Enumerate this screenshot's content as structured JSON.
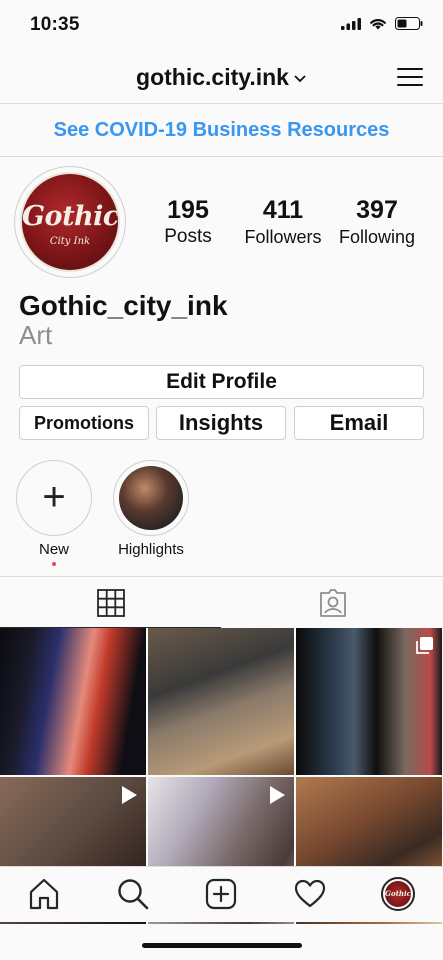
{
  "status_bar": {
    "time": "10:35"
  },
  "header": {
    "username": "gothic.city.ink"
  },
  "banner": {
    "text": "See COVID-19 Business Resources"
  },
  "profile": {
    "avatar_text": "Gothic",
    "avatar_subtext": "City Ink",
    "posts_count": "195",
    "posts_label": "Posts",
    "followers_count": "411",
    "followers_label": "Followers",
    "following_count": "397",
    "following_label": "Following",
    "display_name": "Gothic_city_ink",
    "category": "Art"
  },
  "buttons": {
    "edit_profile": "Edit Profile",
    "promotions": "Promotions",
    "insights": "Insights",
    "email": "Email"
  },
  "highlights": [
    {
      "label": "New",
      "icon": "plus-icon"
    },
    {
      "label": "Highlights",
      "icon": "highlight-photo"
    }
  ],
  "tabs": [
    {
      "icon": "grid-icon",
      "selected": true
    },
    {
      "icon": "tagged-icon",
      "selected": false
    }
  ],
  "posts": [
    {
      "type": "photo"
    },
    {
      "type": "photo"
    },
    {
      "type": "carousel",
      "badge": "carousel-icon"
    },
    {
      "type": "video",
      "badge": "video-play-icon"
    },
    {
      "type": "video",
      "badge": "video-play-icon"
    },
    {
      "type": "photo"
    }
  ],
  "bottom_nav": [
    {
      "icon": "home-icon"
    },
    {
      "icon": "search-icon"
    },
    {
      "icon": "new-post-icon"
    },
    {
      "icon": "heart-icon"
    },
    {
      "icon": "profile-avatar"
    }
  ],
  "colors": {
    "link_blue": "#3897f0",
    "notification_red": "#ed4956",
    "avatar_red": "#7d1518"
  }
}
